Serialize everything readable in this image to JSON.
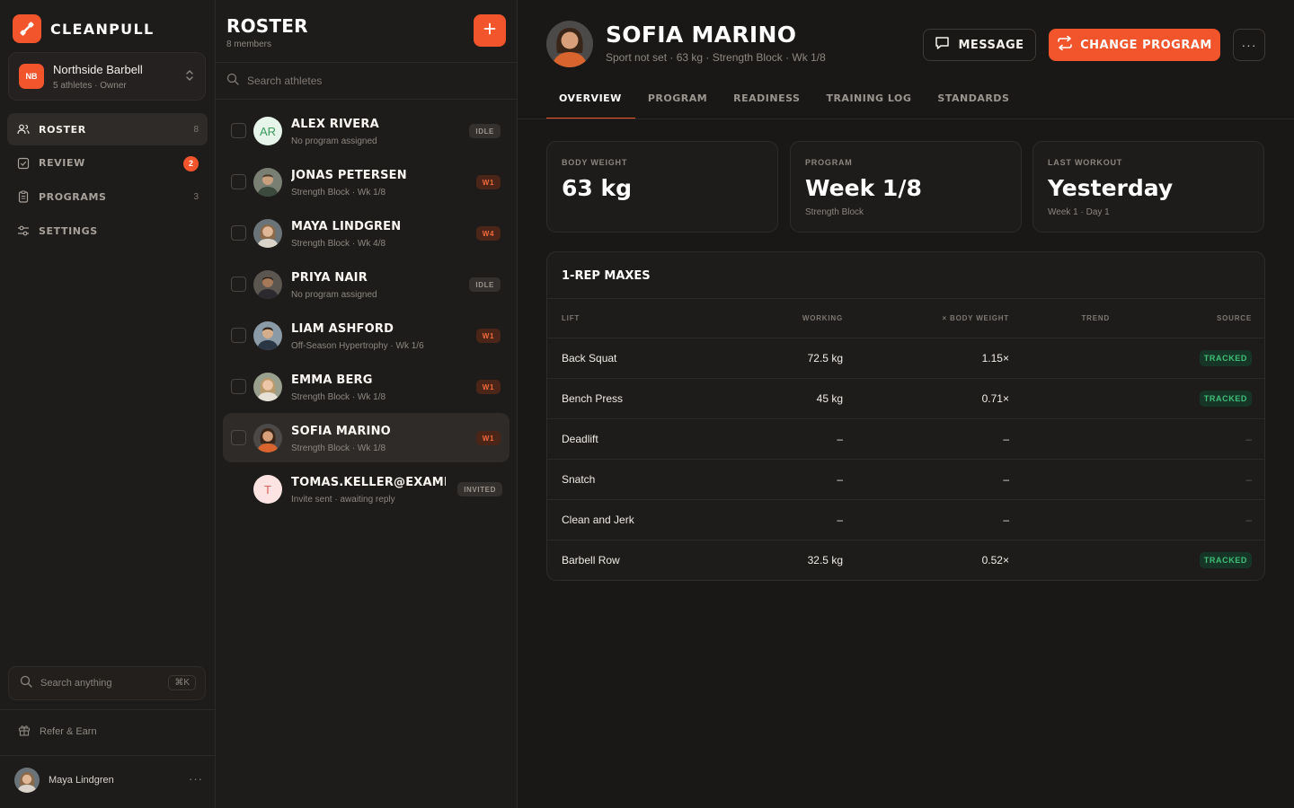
{
  "brand": {
    "name": "CLEANPULL"
  },
  "team": {
    "initials": "NB",
    "name": "Northside Barbell",
    "meta": "5 athletes · Owner"
  },
  "nav": [
    {
      "label": "ROSTER",
      "count": "8",
      "icon": "users-icon"
    },
    {
      "label": "REVIEW",
      "badge": "2",
      "icon": "check-square-icon"
    },
    {
      "label": "PROGRAMS",
      "count": "3",
      "icon": "clipboard-icon"
    },
    {
      "label": "SETTINGS",
      "icon": "sliders-icon"
    }
  ],
  "global_search": {
    "placeholder": "Search anything",
    "shortcut": "⌘K"
  },
  "refer": {
    "label": "Refer & Earn"
  },
  "current_user": {
    "name": "Maya Lindgren"
  },
  "roster": {
    "title": "ROSTER",
    "subtitle": "8 members",
    "search_placeholder": "Search athletes",
    "athletes": [
      {
        "name": "ALEX RIVERA",
        "sub": "No program assigned",
        "status": "IDLE",
        "initials": "AR"
      },
      {
        "name": "JONAS PETERSEN",
        "sub": "Strength Block · Wk 1/8",
        "status": "W1"
      },
      {
        "name": "MAYA LINDGREN",
        "sub": "Strength Block · Wk 4/8",
        "status": "W4"
      },
      {
        "name": "PRIYA NAIR",
        "sub": "No program assigned",
        "status": "IDLE"
      },
      {
        "name": "LIAM ASHFORD",
        "sub": "Off-Season Hypertrophy · Wk 1/6",
        "status": "W1"
      },
      {
        "name": "EMMA BERG",
        "sub": "Strength Block · Wk 1/8",
        "status": "W1"
      },
      {
        "name": "SOFIA MARINO",
        "sub": "Strength Block · Wk 1/8",
        "status": "W1"
      },
      {
        "name": "TOMAS.KELLER@EXAMPL...",
        "sub": "Invite sent · awaiting reply",
        "status": "INVITED",
        "initials": "T"
      }
    ]
  },
  "profile": {
    "name": "SOFIA MARINO",
    "subtitle": "Sport not set · 63 kg · Strength Block · Wk 1/8",
    "message_label": "MESSAGE",
    "change_program_label": "CHANGE PROGRAM",
    "more_label": "···"
  },
  "tabs": [
    "OVERVIEW",
    "PROGRAM",
    "READINESS",
    "TRAINING LOG",
    "STANDARDS"
  ],
  "stats": [
    {
      "label": "BODY WEIGHT",
      "value": "63 kg",
      "sub": ""
    },
    {
      "label": "PROGRAM",
      "value": "Week 1/8",
      "sub": "Strength Block"
    },
    {
      "label": "LAST WORKOUT",
      "value": "Yesterday",
      "sub": "Week 1 · Day 1"
    }
  ],
  "maxes": {
    "title": "1-REP MAXES",
    "columns": [
      "LIFT",
      "WORKING",
      "× BODY WEIGHT",
      "TREND",
      "SOURCE"
    ],
    "rows": [
      {
        "lift": "Back Squat",
        "working": "72.5 kg",
        "ratio": "1.15×",
        "source": "TRACKED"
      },
      {
        "lift": "Bench Press",
        "working": "45 kg",
        "ratio": "0.71×",
        "source": "TRACKED"
      },
      {
        "lift": "Deadlift",
        "working": "–",
        "ratio": "–",
        "source": "–"
      },
      {
        "lift": "Snatch",
        "working": "–",
        "ratio": "–",
        "source": "–"
      },
      {
        "lift": "Clean and Jerk",
        "working": "–",
        "ratio": "–",
        "source": "–"
      },
      {
        "lift": "Barbell Row",
        "working": "32.5 kg",
        "ratio": "0.52×",
        "source": "TRACKED"
      }
    ]
  },
  "colors": {
    "accent": "#f2552c",
    "tracked": "#3fbf78",
    "background": "#1a1816"
  }
}
